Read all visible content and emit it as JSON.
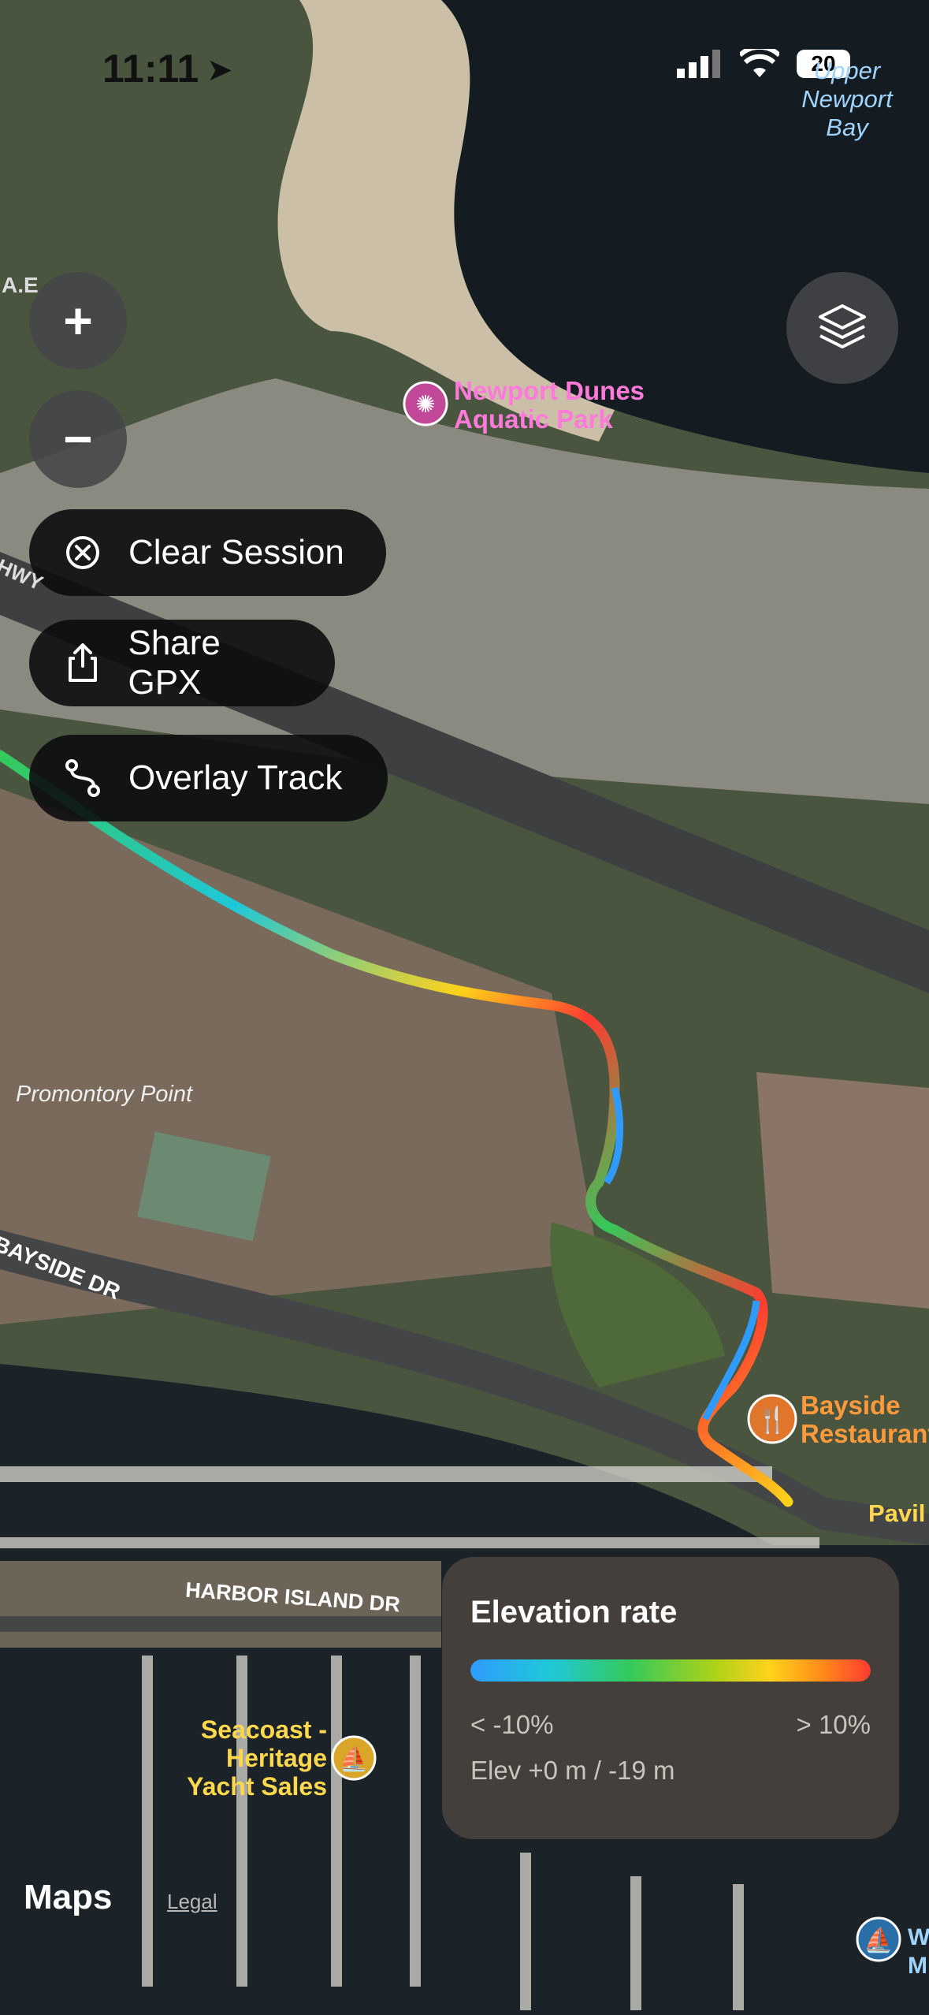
{
  "status_bar": {
    "time": "11:11",
    "battery": "20"
  },
  "colors": {
    "route_gradient": [
      "#2f9bff",
      "#1fc8d8",
      "#35c95a",
      "#a8d21a",
      "#ffd21a",
      "#ff8a1a",
      "#ff3b30"
    ],
    "poi_pink": "#ff7ad9",
    "poi_orange": "#ff9a3c",
    "poi_yellow": "#ffd84d"
  },
  "map_controls": {
    "zoom_in": "+",
    "zoom_out": "−",
    "layers_icon": "layers-icon"
  },
  "actions": {
    "clear_session": "Clear Session",
    "share_gpx": "Share GPX",
    "overlay_track": "Overlay Track"
  },
  "map_labels": {
    "upper_newport_bay": [
      "Upper",
      "Newport",
      "Bay"
    ],
    "newport_dunes": [
      "Newport Dunes",
      "Aquatic Park"
    ],
    "promontory_point": "Promontory Point",
    "bayside_dr": "BAYSIDE DR",
    "bayside_restaurant": [
      "Bayside",
      "Restaurant"
    ],
    "pavil": "Pavil",
    "harbor_island_dr": "HARBOR ISLAND DR",
    "seacoast": [
      "Seacoast -",
      "Heritage",
      "Yacht Sales"
    ],
    "hwy": "HWY",
    "ae": "A.E",
    "w_m": [
      "W",
      "M"
    ]
  },
  "legend": {
    "title": "Elevation rate",
    "min_label": "< -10%",
    "max_label": "> 10%",
    "elevation": "Elev +0 m / -19 m"
  },
  "footer": {
    "maps_logo": "Maps",
    "legal": "Legal"
  }
}
